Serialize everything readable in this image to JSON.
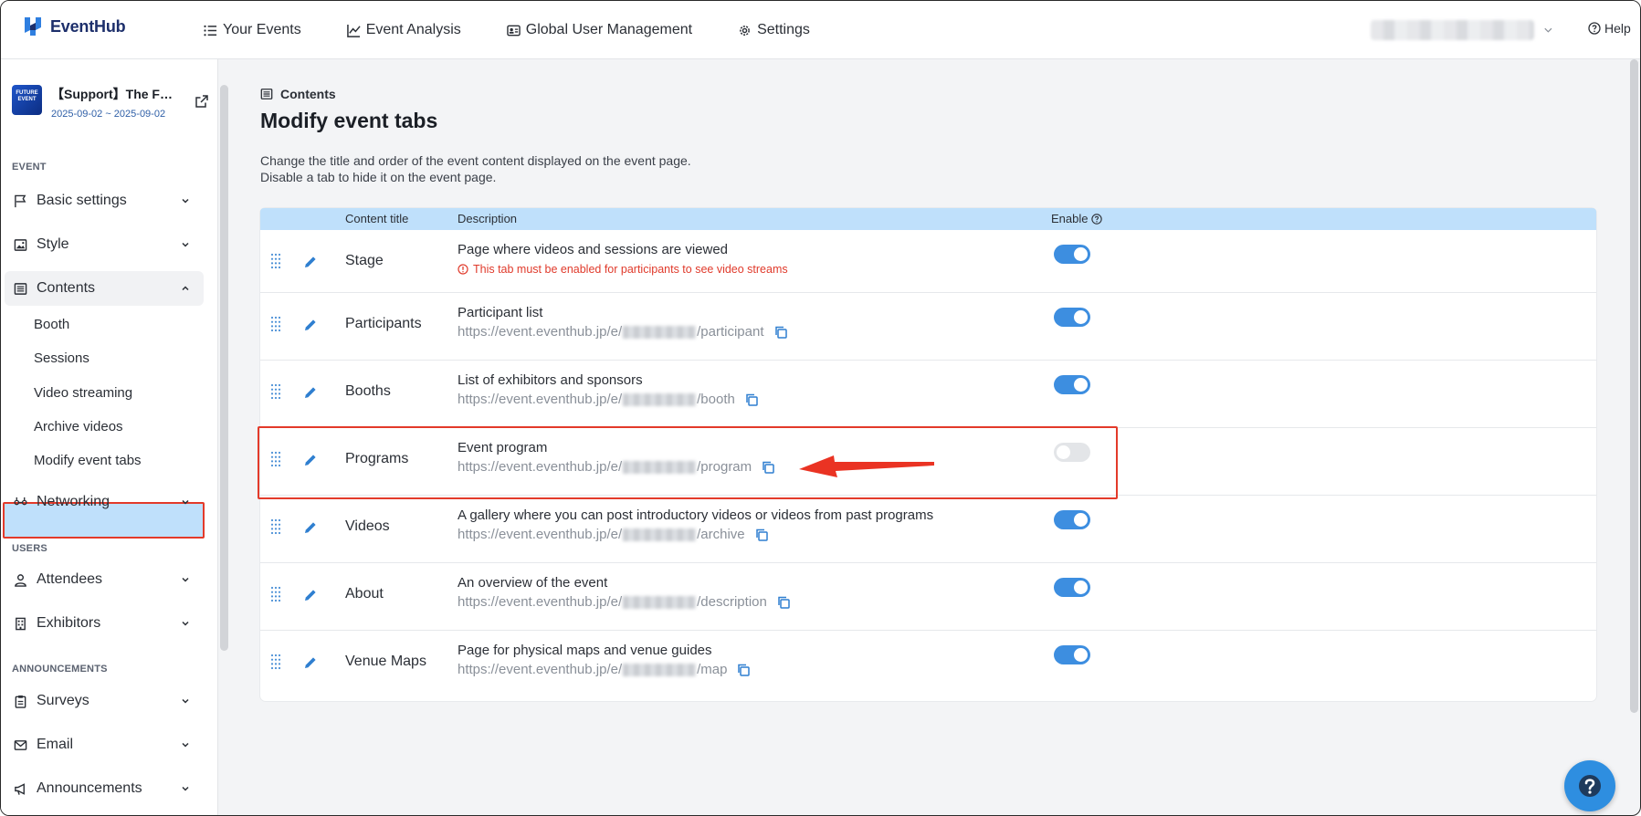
{
  "app": {
    "name": "EventHub",
    "help_label": "Help"
  },
  "nav": [
    {
      "label": "Your Events",
      "icon": "list-icon"
    },
    {
      "label": "Event Analysis",
      "icon": "chart-icon"
    },
    {
      "label": "Global User Management",
      "icon": "id-card-icon"
    },
    {
      "label": "Settings",
      "icon": "gear-icon"
    }
  ],
  "event": {
    "name": "【Support】The F…",
    "dates": "2025-09-02 ~ 2025-09-02",
    "thumb_text": "FUTURE EVENT"
  },
  "sidebar": {
    "section_event": "EVENT",
    "section_users": "USERS",
    "section_announcements": "ANNOUNCEMENTS",
    "basic_settings": "Basic settings",
    "style": "Style",
    "contents": "Contents",
    "contents_sub": [
      "Booth",
      "Sessions",
      "Video streaming",
      "Archive videos",
      "Modify event tabs"
    ],
    "networking": "Networking",
    "attendees": "Attendees",
    "exhibitors": "Exhibitors",
    "surveys": "Surveys",
    "email": "Email",
    "announcements": "Announcements"
  },
  "page": {
    "breadcrumb": "Contents",
    "title": "Modify event tabs",
    "desc_line1": "Change the title and order of the event content displayed on the event page.",
    "desc_line2": "Disable a tab to hide it on the event page."
  },
  "table": {
    "headers": {
      "title": "Content title",
      "description": "Description",
      "enable": "Enable"
    },
    "rows": [
      {
        "title": "Stage",
        "description": "Page where videos and sessions are viewed",
        "warning": "This tab must be enabled for participants to see video streams",
        "enabled": true
      },
      {
        "title": "Participants",
        "description": "Participant list",
        "url_prefix": "https://event.eventhub.jp/e/",
        "url_suffix": "/participant",
        "enabled": true
      },
      {
        "title": "Booths",
        "description": "List of exhibitors and sponsors",
        "url_prefix": "https://event.eventhub.jp/e/",
        "url_suffix": "/booth",
        "enabled": true
      },
      {
        "title": "Programs",
        "description": "Event program",
        "url_prefix": "https://event.eventhub.jp/e/",
        "url_suffix": "/program",
        "enabled": false
      },
      {
        "title": "Videos",
        "description": "A gallery where you can post introductory videos or videos from past programs",
        "url_prefix": "https://event.eventhub.jp/e/",
        "url_suffix": "/archive",
        "enabled": true
      },
      {
        "title": "About",
        "description": "An overview of the event",
        "url_prefix": "https://event.eventhub.jp/e/",
        "url_suffix": "/description",
        "enabled": true
      },
      {
        "title": "Venue Maps",
        "description": "Page for physical maps and venue guides",
        "url_prefix": "https://event.eventhub.jp/e/",
        "url_suffix": "/map",
        "enabled": true
      }
    ]
  },
  "colors": {
    "accent": "#3d8ee0",
    "highlight": "#e33a2a",
    "header_row": "#bfe0fb"
  }
}
